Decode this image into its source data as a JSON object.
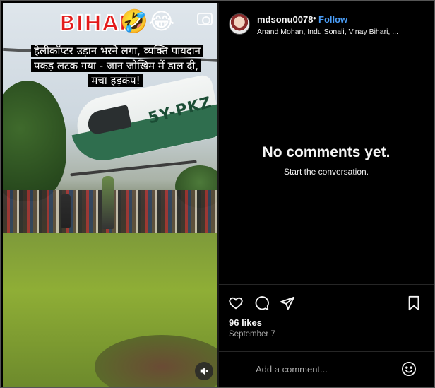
{
  "media": {
    "overlay_title": "BIHAR",
    "overlay_emojis": [
      "🤣",
      "😂"
    ],
    "caption": "हेलीकॉप्टर उड़ान भरने लगा, व्यक्ति पायदान पकड़ लटक गया - जान जोखिम में डाल दी, मचा हड़कंप!",
    "helicopter_registration": "5Y-PKZ",
    "icons": {
      "camera": "camera-icon",
      "mute": "speaker-muted-icon"
    }
  },
  "post": {
    "username": "mdsonu0078",
    "separator": "•",
    "follow_label": "Follow",
    "audio_text": "Anand Mohan, Indu Sonali, Vinay Bihari, ..."
  },
  "comments": {
    "empty_title": "No comments yet.",
    "empty_subtitle": "Start the conversation."
  },
  "actions": {
    "icons": [
      "heart-icon",
      "comment-icon",
      "share-icon",
      "bookmark-icon"
    ],
    "likes": "96 likes",
    "date": "September 7"
  },
  "composer": {
    "placeholder": "Add a comment...",
    "emoji_icon": "smiley-icon"
  },
  "colors": {
    "background": "#000000",
    "link": "#4a9df6",
    "muted_text": "#a8a8a8",
    "divider": "#262626"
  }
}
